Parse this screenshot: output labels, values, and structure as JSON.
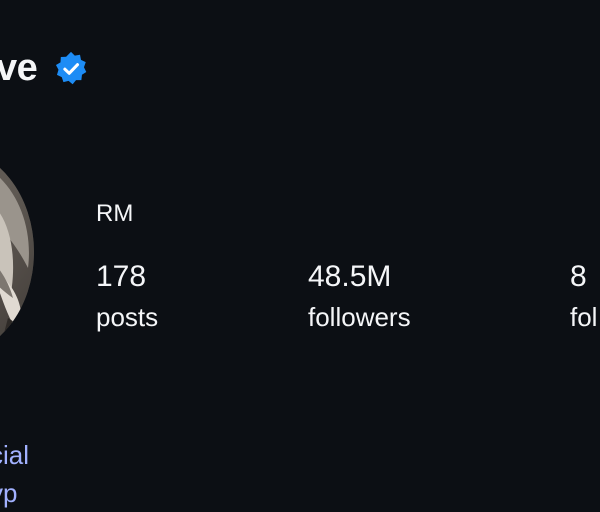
{
  "profile": {
    "username": "ve",
    "verified_icon": "verified-badge-icon",
    "display_name": "RM",
    "avatar": "profile-avatar"
  },
  "stats": {
    "posts": {
      "value": "178",
      "label": "posts"
    },
    "followers": {
      "value": "48.5M",
      "label": "followers"
    },
    "following": {
      "value": "8",
      "label": "fol"
    }
  },
  "bio": {
    "links": [
      "cial",
      "yp"
    ]
  },
  "colors": {
    "background": "#0c0f14",
    "text": "#f5f6f8",
    "verified_blue": "#1d8cf5",
    "link": "#a2b1ff"
  }
}
